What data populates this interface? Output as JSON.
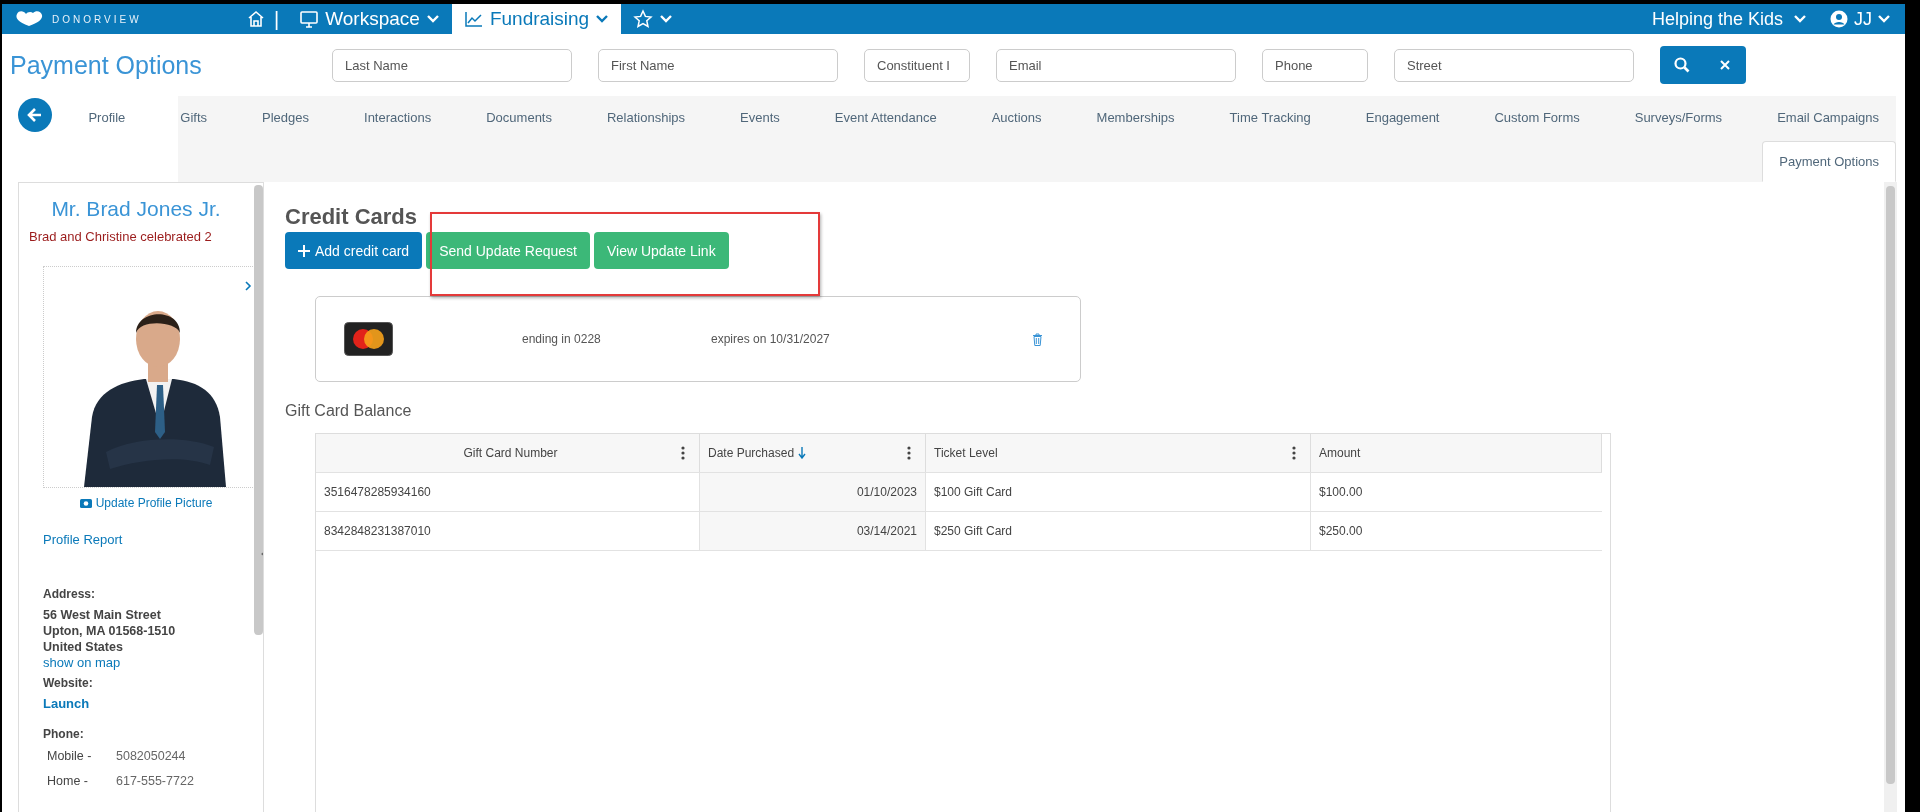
{
  "nav": {
    "brand": "DONORVIEW",
    "separator": "|",
    "menus": [
      {
        "kind": "menu",
        "label": "Workspace",
        "selected": false
      },
      {
        "kind": "menu",
        "label": "Fundraising",
        "selected": true
      },
      {
        "kind": "favorites",
        "selected": false
      }
    ],
    "org": "Helping the Kids",
    "user": "JJ"
  },
  "page_title": "Payment Options",
  "search": {
    "fields": [
      {
        "placeholder": "Last Name"
      },
      {
        "placeholder": "First Name"
      },
      {
        "placeholder": "Constituent I"
      },
      {
        "placeholder": "Email"
      },
      {
        "placeholder": "Phone"
      },
      {
        "placeholder": "Street"
      }
    ]
  },
  "tab_rows": [
    {
      "tabs": [
        {
          "label": "Profile",
          "selected": false
        },
        {
          "label": "Gifts",
          "selected": false
        },
        {
          "label": "Pledges",
          "selected": false
        },
        {
          "label": "Interactions",
          "selected": false
        },
        {
          "label": "Documents",
          "selected": false
        },
        {
          "label": "Relationships",
          "selected": false
        },
        {
          "label": "Events",
          "selected": false
        },
        {
          "label": "Event Attendance",
          "selected": false
        },
        {
          "label": "Auctions",
          "selected": false
        },
        {
          "label": "Memberships",
          "selected": false
        },
        {
          "label": "Time Tracking",
          "selected": false
        },
        {
          "label": "Engagement",
          "selected": false
        },
        {
          "label": "Custom Forms",
          "selected": false
        },
        {
          "label": "Surveys/Forms",
          "selected": false
        },
        {
          "label": "Email Campaigns",
          "selected": false
        }
      ]
    },
    {
      "tabs": [
        {
          "label": "Payment Options",
          "selected": true
        }
      ]
    }
  ],
  "profile": {
    "name": "Mr. Brad Jones Jr.",
    "note": "Brad and Christine celebrated 2",
    "update_picture": "Update Profile Picture",
    "report": "Profile Report",
    "address": {
      "label": "Address:",
      "lines": [
        "56 West Main Street",
        "Upton, MA 01568-1510",
        "United States"
      ],
      "map_link": "show on map"
    },
    "website": {
      "label": "Website:",
      "link": "Launch"
    },
    "phone": {
      "label": "Phone:",
      "numbers": [
        {
          "type": "Mobile -",
          "number": "5082050244"
        },
        {
          "type": "Home -",
          "number": "617-555-7722"
        }
      ]
    }
  },
  "credit_cards": {
    "title": "Credit Cards",
    "buttons": [
      {
        "label": "Add credit card",
        "kind": "primary"
      },
      {
        "label": "Send Update Request",
        "kind": "success"
      },
      {
        "label": "View Update Link",
        "kind": "success"
      }
    ],
    "cards": [
      {
        "ending": "ending in 0228",
        "expires": "expires on 10/31/2027"
      }
    ]
  },
  "gift_cards": {
    "title": "Gift Card Balance",
    "columns": [
      {
        "label": "Gift Card Number",
        "sorted": false,
        "menu": true
      },
      {
        "label": "Date Purchased",
        "sorted": true,
        "menu": true
      },
      {
        "label": "Ticket Level",
        "sorted": false,
        "menu": true
      },
      {
        "label": "Amount",
        "sorted": false,
        "menu": false
      }
    ],
    "rows": [
      [
        "3516478285934160",
        "01/10/2023",
        "$100 Gift Card",
        "$100.00"
      ],
      [
        "8342848231387010",
        "03/14/2021",
        "$250 Gift Card",
        "$250.00"
      ]
    ]
  }
}
